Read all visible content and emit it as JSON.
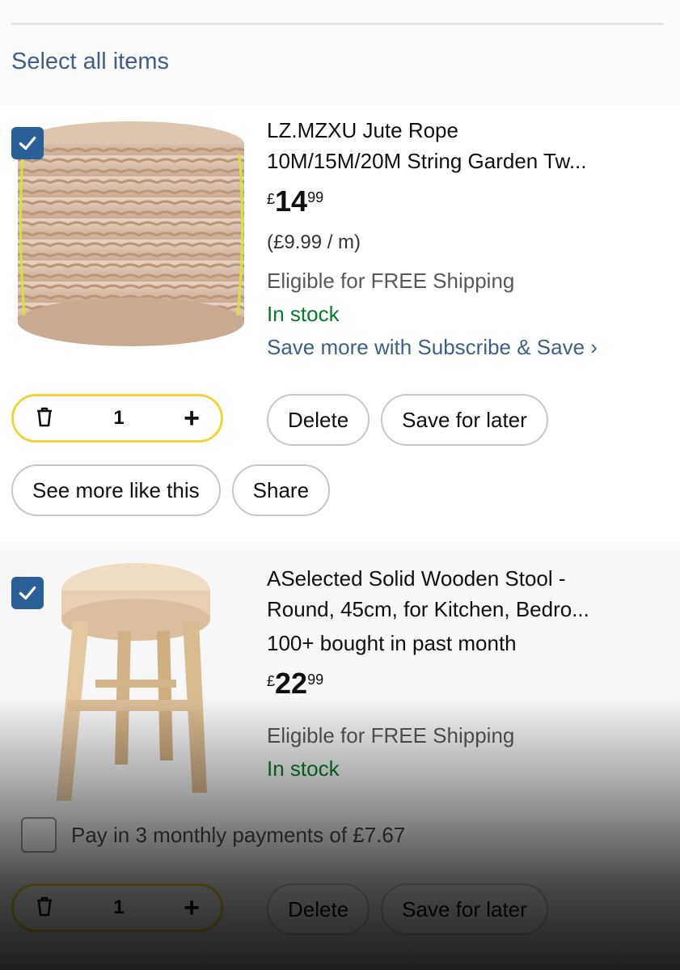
{
  "header": {
    "select_all": "Select all items"
  },
  "items": [
    {
      "title_line1": "LZ.MZXU Jute Rope",
      "title_line2": "10M/15M/20M String Garden Tw...",
      "price_currency": "£",
      "price_whole": "14",
      "price_fraction": "99",
      "unit_price": "(£9.99 / m)",
      "shipping": "Eligible for FREE Shipping",
      "stock": "In stock",
      "subscribe": "Save more with Subscribe & Save ›",
      "quantity": "1",
      "delete_label": "Delete",
      "save_label": "Save for later",
      "see_more_label": "See more like this",
      "share_label": "Share",
      "checked": true,
      "image_icon": "rope-coil-image"
    },
    {
      "title_line1": "ASelected Solid Wooden Stool -",
      "title_line2": "Round, 45cm, for Kitchen, Bedro...",
      "bought": "100+ bought in past month",
      "price_currency": "£",
      "price_whole": "22",
      "price_fraction": "99",
      "shipping": "Eligible for FREE Shipping",
      "stock": "In stock",
      "installments": "Pay in 3 monthly payments of £7.67",
      "quantity": "1",
      "delete_label": "Delete",
      "save_label": "Save for later",
      "checked": true,
      "image_icon": "wooden-stool-image"
    }
  ],
  "colors": {
    "link": "#3f5f86",
    "stock": "#087a2a",
    "checkbox": "#2b5f97",
    "qty_border": "#f2d33e"
  }
}
